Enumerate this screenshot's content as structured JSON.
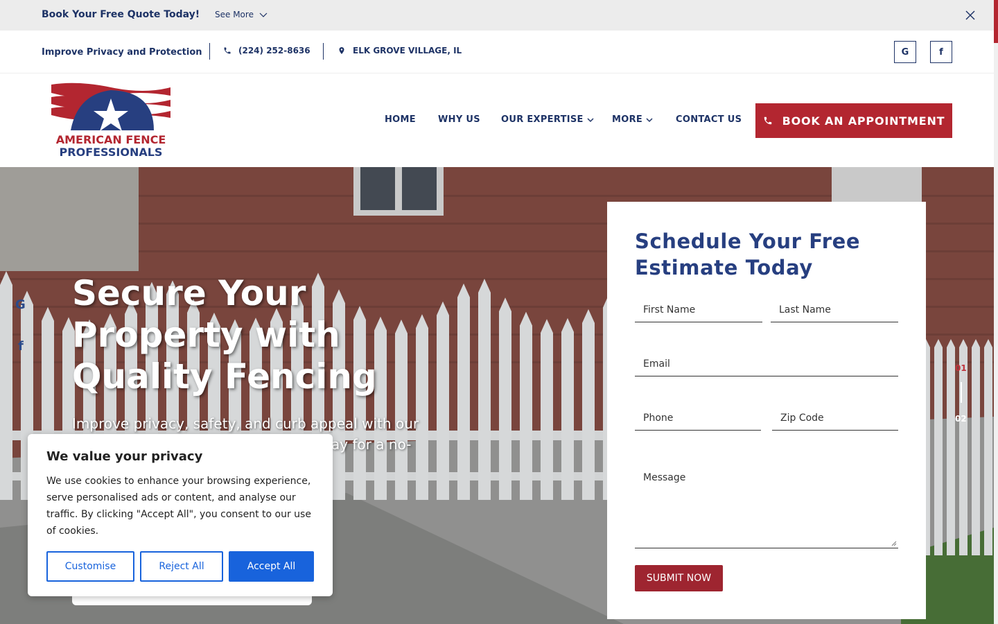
{
  "promo": {
    "title": "Book Your Free Quote Today!",
    "see_more": "See More"
  },
  "info_bar": {
    "tagline": "Improve Privacy and Protection",
    "phone": "(224) 252-8636",
    "location": "ELK GROVE VILLAGE, IL",
    "social": [
      "G",
      "f"
    ]
  },
  "header": {
    "logo_alt": "AMERICAN FENCE PROFESSIONALS",
    "logo_line1": "AMERICAN FENCE",
    "logo_line2": "PROFESSIONALS",
    "nav": {
      "home": "HOME",
      "why_us": "WHY US",
      "expertise": "OUR EXPERTISE",
      "more": "MORE",
      "contact": "CONTACT US"
    },
    "cta": "BOOK AN APPOINTMENT"
  },
  "hero": {
    "title": "Secure Your Property with Quality Fencing",
    "subtitle": "Improve privacy, safety, and curb appeal with our",
    "subtitle_line2": "ay for a no-",
    "side_social": [
      "G",
      "f"
    ],
    "slides": [
      "01",
      "02"
    ]
  },
  "form": {
    "title": "Schedule Your Free Estimate Today",
    "first_name": "First Name",
    "last_name": "Last Name",
    "email": "Email",
    "phone": "Phone",
    "zip": "Zip Code",
    "message": "Message",
    "submit": "SUBMIT NOW"
  },
  "cookie": {
    "title": "We value your privacy",
    "text": "We use cookies to enhance your browsing experience, serve personalised ads or content, and analyse our traffic. By clicking \"Accept All\", you consent to our use of cookies.",
    "customise": "Customise",
    "reject": "Reject All",
    "accept": "Accept All"
  },
  "colors": {
    "brand_red": "#b32630",
    "brand_navy": "#1e3366",
    "accept_blue": "#1863dc"
  }
}
